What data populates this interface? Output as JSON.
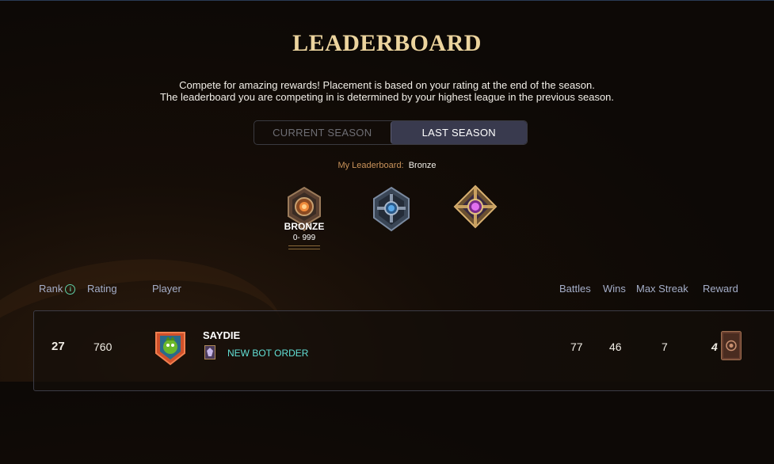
{
  "page": {
    "title": "LEADERBOARD",
    "description_line1": "Compete for amazing rewards! Placement is based on your rating at the end of the season.",
    "description_line2": "The leaderboard you are competing in is determined by your highest league in the previous season."
  },
  "tabs": [
    {
      "label": "CURRENT SEASON",
      "active": false
    },
    {
      "label": "LAST SEASON",
      "active": true
    }
  ],
  "my_leaderboard": {
    "label": "My Leaderboard:",
    "value": "Bronze"
  },
  "leagues": [
    {
      "name": "BRONZE",
      "range": "0- 999",
      "icon": "bronze-league-icon",
      "selected": true,
      "color": "#c07a3a"
    },
    {
      "name": "",
      "icon": "silver-league-icon",
      "selected": false,
      "color": "#4a7fb5"
    },
    {
      "name": "",
      "icon": "gold-league-icon",
      "selected": false,
      "color": "#c84fd0"
    }
  ],
  "columns": {
    "rank": "Rank",
    "rating": "Rating",
    "player": "Player",
    "battles": "Battles",
    "wins": "Wins",
    "max_streak": "Max Streak",
    "reward": "Reward"
  },
  "rows": [
    {
      "rank": "27",
      "rating": "760",
      "player": "SAYDIE",
      "guild": "NEW BOT ORDER",
      "battles": "77",
      "wins": "46",
      "max_streak": "7",
      "reward_count": "4",
      "avatar_icon": "player-avatar-icon",
      "reward_icon": "reward-card-icon"
    }
  ],
  "colors": {
    "accent_gold": "#ecd49e",
    "guild_cyan": "#62e0d6",
    "header_text": "#a5aec8",
    "active_tab": "#393a4e"
  }
}
